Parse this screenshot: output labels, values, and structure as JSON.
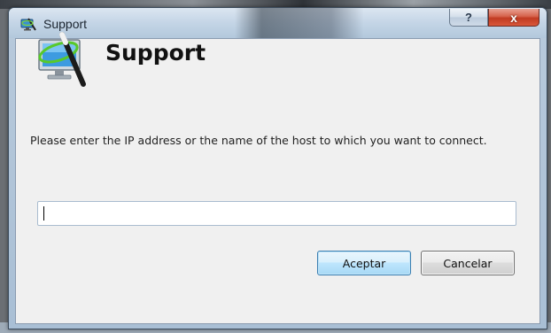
{
  "window": {
    "title": "Support",
    "help_glyph": "?",
    "close_glyph": "x"
  },
  "header": {
    "title": "Support",
    "icon": "support-monitor-wand-icon"
  },
  "prompt": {
    "text": "Please enter the IP address or the name of the host to which you want to connect."
  },
  "host_input": {
    "value": "",
    "placeholder": ""
  },
  "buttons": {
    "ok_label": "Aceptar",
    "cancel_label": "Cancelar"
  },
  "colors": {
    "ok_border": "#3c7fb1",
    "close_button": "#c13b22",
    "client_background": "#f0f0f0"
  }
}
